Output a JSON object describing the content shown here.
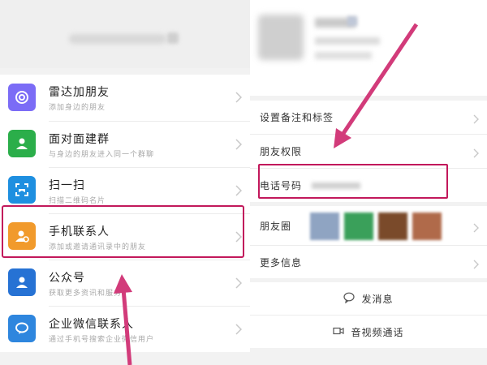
{
  "left_panel": {
    "items": [
      {
        "title": "雷达加朋友",
        "subtitle": "添加身边的朋友",
        "icon": "radar-icon",
        "color": "#7b6cf6"
      },
      {
        "title": "面对面建群",
        "subtitle": "与身边的朋友进入同一个群聊",
        "icon": "face-to-face-group-icon",
        "color": "#2bae4a"
      },
      {
        "title": "扫一扫",
        "subtitle": "扫描二维码名片",
        "icon": "scan-icon",
        "color": "#1e8fe0"
      },
      {
        "title": "手机联系人",
        "subtitle": "添加或邀请通讯录中的朋友",
        "icon": "phone-contacts-icon",
        "color": "#f19a2c"
      },
      {
        "title": "公众号",
        "subtitle": "获取更多资讯和服务",
        "icon": "official-account-icon",
        "color": "#2672d4"
      },
      {
        "title": "企业微信联系人",
        "subtitle": "通过手机号搜索企业微信用户",
        "icon": "work-wechat-icon",
        "color": "#2e86de"
      }
    ]
  },
  "right_panel": {
    "rows": [
      {
        "label": "设置备注和标签"
      },
      {
        "label": "朋友权限"
      },
      {
        "label": "电话号码"
      }
    ],
    "moments_label": "朋友圈",
    "moments_thumbs": [
      "#8fa4c2",
      "#3aa05a",
      "#7a4a2a",
      "#b06a4a"
    ],
    "more_label": "更多信息",
    "actions": [
      {
        "label": "发消息",
        "icon": "chat-bubble-icon"
      },
      {
        "label": "音视频通话",
        "icon": "video-call-icon"
      }
    ]
  },
  "colors": {
    "highlight": "#c2185b",
    "arrow": "#d23b7a"
  }
}
